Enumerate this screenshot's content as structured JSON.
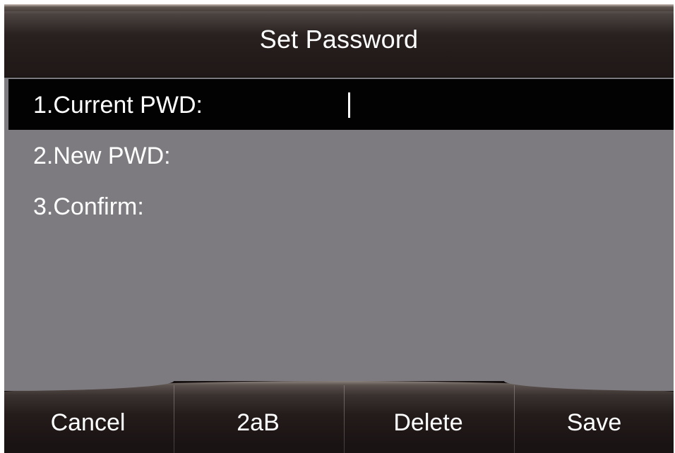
{
  "title": "Set Password",
  "fields": [
    {
      "label": "1.Current PWD:",
      "value": "",
      "selected": true
    },
    {
      "label": "2.New PWD:",
      "value": "",
      "selected": false
    },
    {
      "label": "3.Confirm:",
      "value": "",
      "selected": false
    }
  ],
  "softkeys": {
    "cancel": "Cancel",
    "input_mode": "2aB",
    "delete": "Delete",
    "save": "Save"
  },
  "colors": {
    "screen_background": "#7e7b80",
    "selected_row": "#020202",
    "text": "#ffffff",
    "title_bar": "#241c1b",
    "softkey_bar": "#1a1313"
  }
}
